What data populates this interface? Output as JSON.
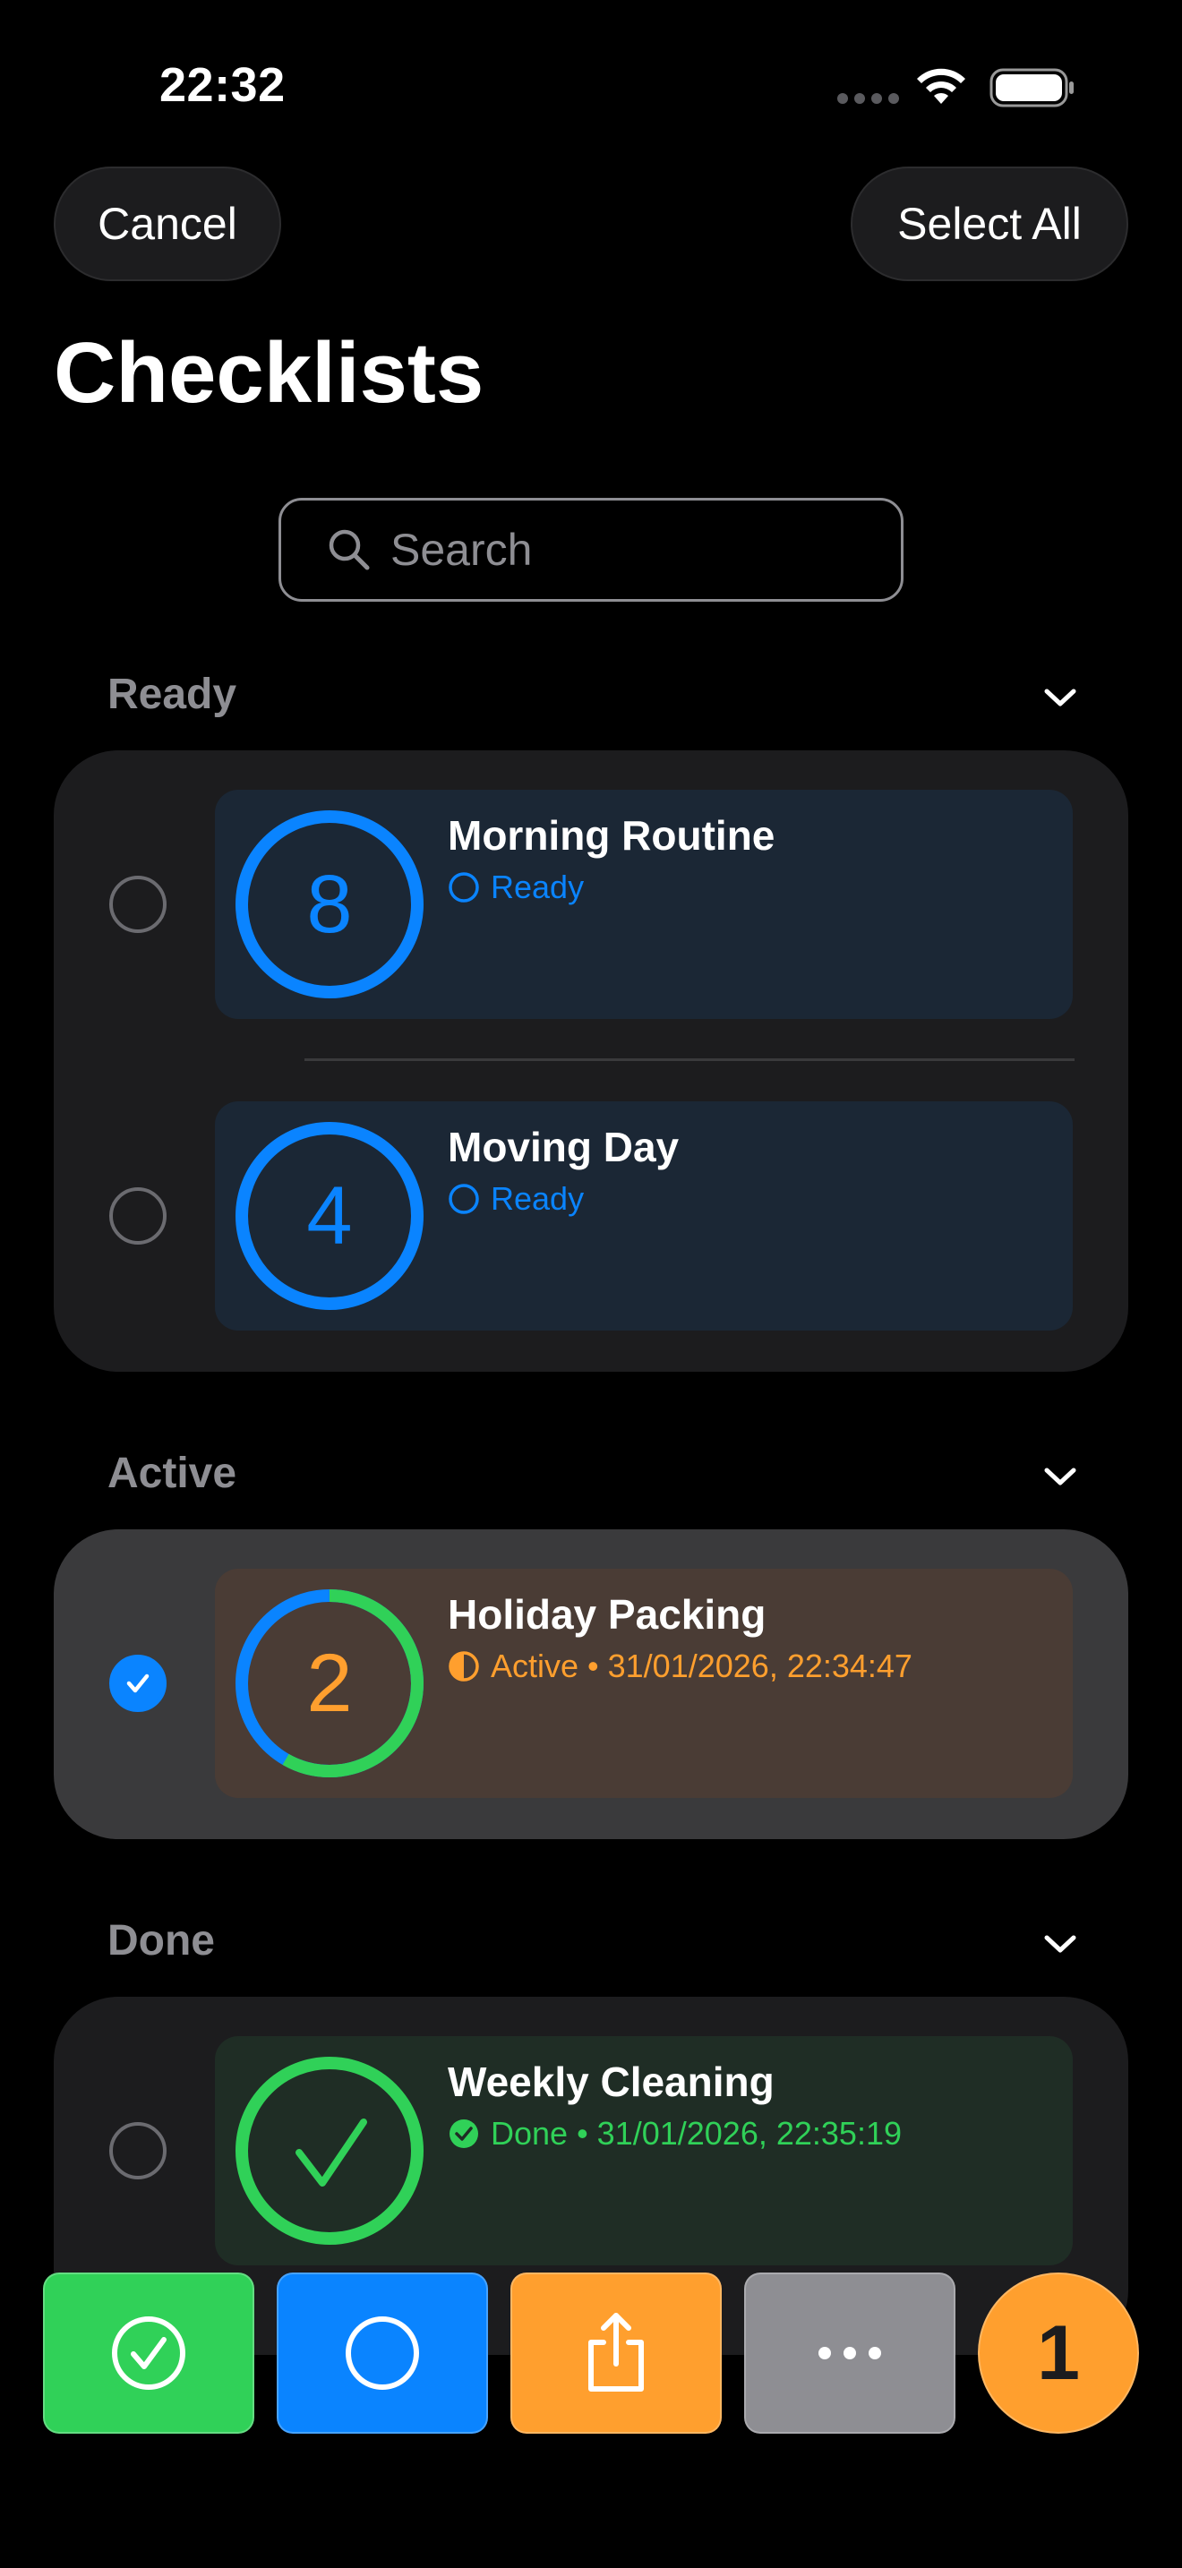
{
  "status_bar": {
    "time": "22:32"
  },
  "header": {
    "cancel_label": "Cancel",
    "select_all_label": "Select All",
    "title": "Checklists"
  },
  "search": {
    "placeholder": "Search"
  },
  "sections": {
    "ready": {
      "title": "Ready",
      "items": [
        {
          "count": "8",
          "name": "Morning Routine",
          "status": "Ready"
        },
        {
          "count": "4",
          "name": "Moving Day",
          "status": "Ready"
        }
      ]
    },
    "active": {
      "title": "Active",
      "items": [
        {
          "count": "2",
          "name": "Holiday Packing",
          "status": "Active • 31/01/2026, 22:34:47",
          "selected": true
        }
      ]
    },
    "done": {
      "title": "Done",
      "items": [
        {
          "name": "Weekly Cleaning",
          "status": "Done • 31/01/2026, 22:35:19"
        }
      ]
    }
  },
  "toolbar": {
    "buttons": [
      {
        "icon": "checkmark-circle-icon",
        "color": "#30d158"
      },
      {
        "icon": "circle-icon",
        "color": "#0a84ff"
      },
      {
        "icon": "share-icon",
        "color": "#ff9f2e"
      },
      {
        "icon": "ellipsis-icon",
        "color": "#8e8e93"
      }
    ],
    "selected_count": "1"
  },
  "colors": {
    "ready": "#0a84ff",
    "active": "#ff9f2e",
    "done": "#30d158"
  }
}
